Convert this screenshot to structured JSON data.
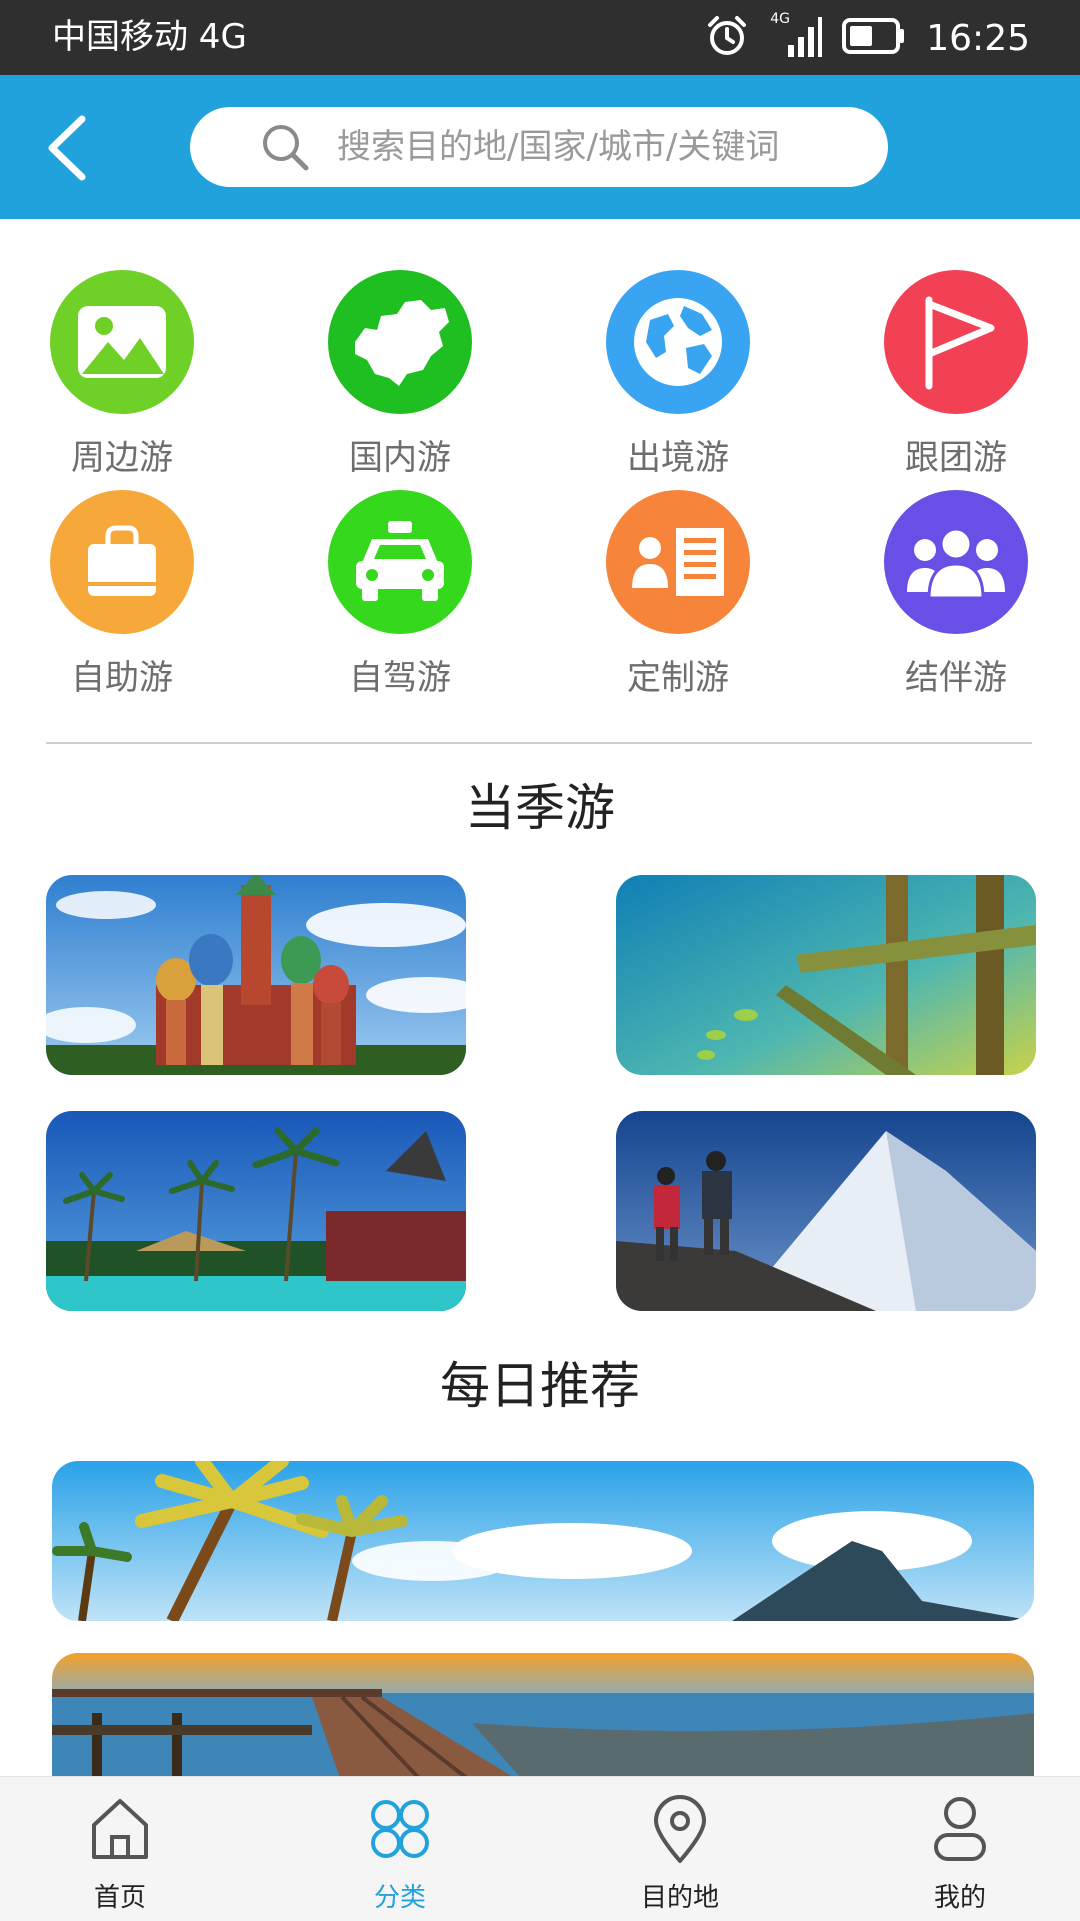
{
  "status_bar": {
    "carrier": "中国移动 4G",
    "network": "4G",
    "time": "16:25"
  },
  "header": {
    "search_placeholder": "搜索目的地/国家/城市/关键词"
  },
  "categories": [
    {
      "label": "周边游",
      "icon": "landscape-icon",
      "color": "#6fd127"
    },
    {
      "label": "国内游",
      "icon": "china-map-icon",
      "color": "#1fbf22"
    },
    {
      "label": "出境游",
      "icon": "globe-icon",
      "color": "#39a5f2"
    },
    {
      "label": "跟团游",
      "icon": "flag-icon",
      "color": "#f24155"
    },
    {
      "label": "自助游",
      "icon": "bag-icon",
      "color": "#f7a83b"
    },
    {
      "label": "自驾游",
      "icon": "car-icon",
      "color": "#35d81c"
    },
    {
      "label": "定制游",
      "icon": "profile-card-icon",
      "color": "#f7843b"
    },
    {
      "label": "结伴游",
      "icon": "group-icon",
      "color": "#6a4fe6"
    }
  ],
  "seasonal": {
    "title": "当季游",
    "photos": [
      "cathedral-photo",
      "lake-pier-photo",
      "tropical-resort-photo",
      "mountain-climbers-photo"
    ]
  },
  "daily": {
    "title": "每日推荐",
    "photos": [
      "palm-beach-banner",
      "pier-sunset-banner"
    ]
  },
  "bottom_nav": [
    {
      "label": "首页",
      "icon": "home-icon",
      "active": false
    },
    {
      "label": "分类",
      "icon": "category-icon",
      "active": true
    },
    {
      "label": "目的地",
      "icon": "location-pin-icon",
      "active": false
    },
    {
      "label": "我的",
      "icon": "user-icon",
      "active": false
    }
  ],
  "colors": {
    "accent": "#22a2dc",
    "status_bar": "#2f2f2f",
    "nav_background": "#f5f5f5"
  }
}
